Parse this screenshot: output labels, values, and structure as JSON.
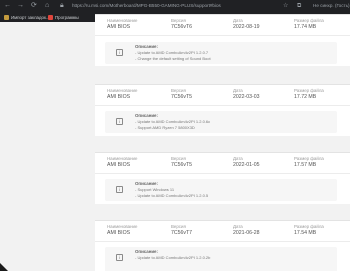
{
  "browser": {
    "address": "https://ru.msi.com/Motherboard/MPG-B550-GAMING-PLUS/support#bios",
    "profile_label": "Не синхр. (Гость)",
    "bookmarks": [
      {
        "label": "Импорт закладок...",
        "color": "#c39b3e"
      },
      {
        "label": "Программы",
        "color": "#e0463d"
      }
    ]
  },
  "columns": {
    "title": "Наименование",
    "version": "Версия",
    "date": "Дата",
    "size": "Размер файла"
  },
  "desc_label": "Описание:",
  "bios_entries": [
    {
      "title": "AMI BIOS",
      "version": "7C56vT6",
      "date": "2022-08-19",
      "size": "17.74 MB",
      "notes": [
        "- Update to AMD ComboAm4v2PI 1.2.0.7",
        "- Change the default setting of Sound Boot"
      ]
    },
    {
      "title": "AMI BIOS",
      "version": "7C56vT5",
      "date": "2022-03-03",
      "size": "17.72 MB",
      "notes": [
        "- Update to AMD ComboAm4v2PI 1.2.0.6c",
        "- Support AMD Ryzen 7 5800X3D"
      ]
    },
    {
      "title": "AMI BIOS",
      "version": "7C56vT5",
      "date": "2022-01-05",
      "size": "17.57 MB",
      "notes": [
        "- Support Windows 11",
        "- Update to AMD ComboAm4v2PI 1.2.0.5"
      ]
    },
    {
      "title": "AMI BIOS",
      "version": "7C56vT7",
      "date": "2021-06-28",
      "size": "17.54 MB",
      "notes": [
        "- Update to AMD ComboAm4v2PI 1.2.0.2b"
      ]
    }
  ]
}
